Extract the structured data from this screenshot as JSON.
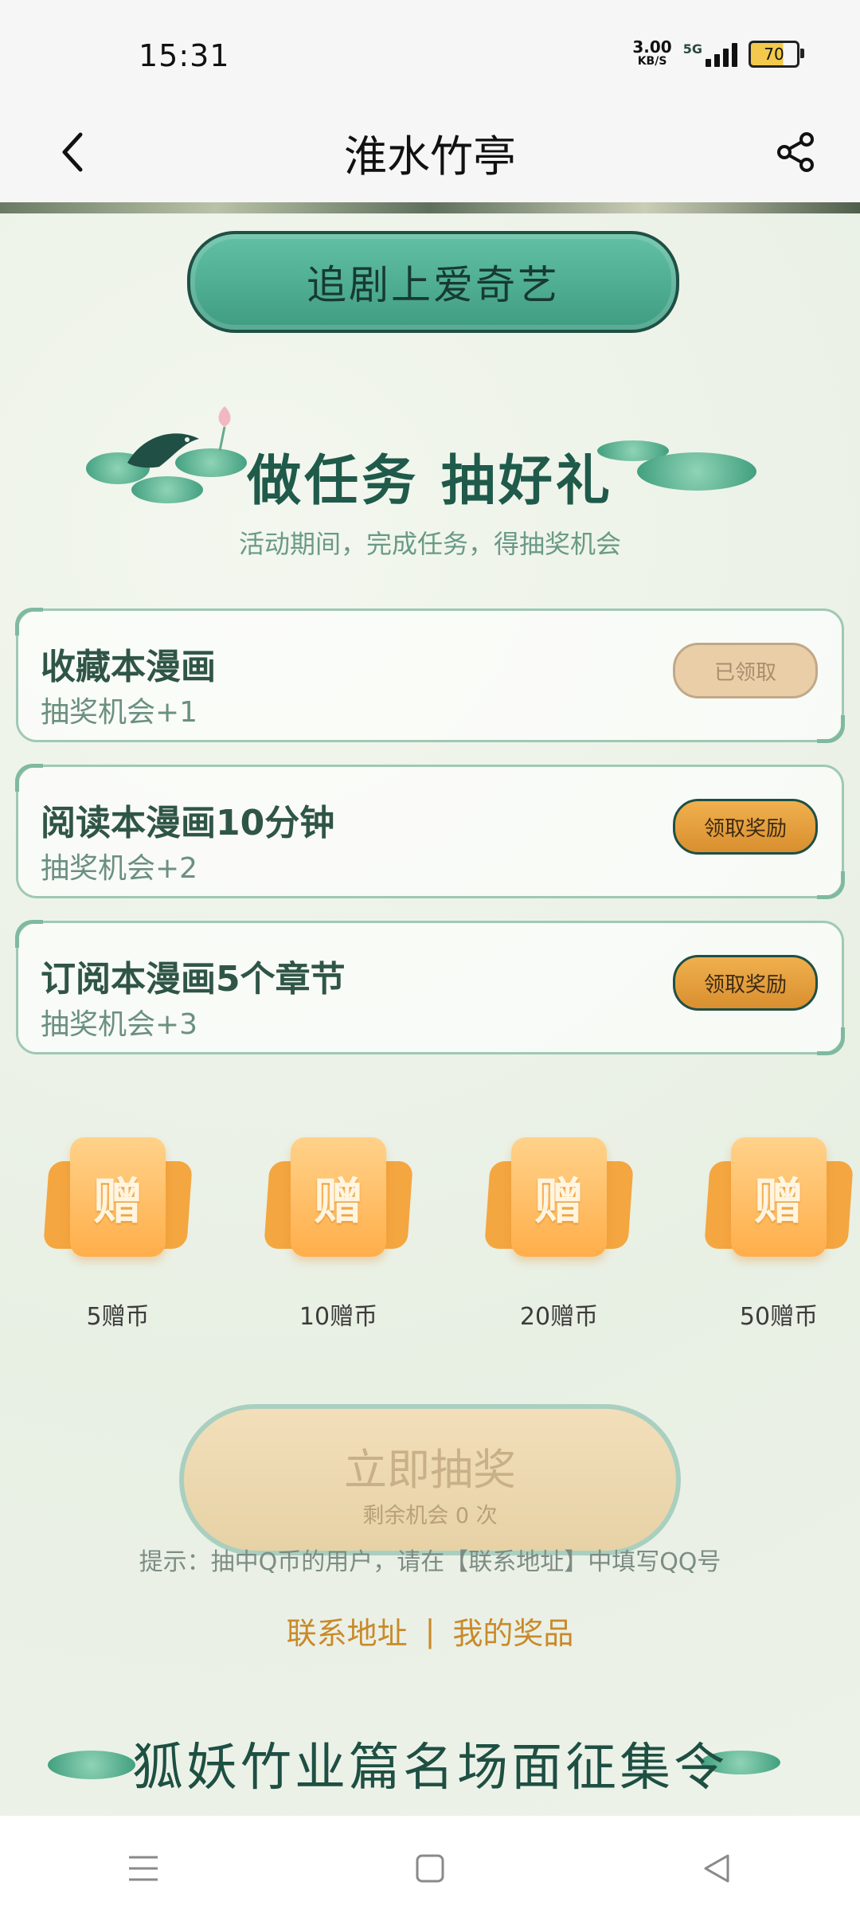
{
  "status": {
    "time": "15:31",
    "net_speed_top": "3.00",
    "net_speed_unit": "KB/S",
    "network": "5G",
    "battery": "70"
  },
  "header": {
    "title": "淮水竹亭"
  },
  "banner": {
    "label": "追剧上爱奇艺"
  },
  "tasks_section": {
    "heading": "做任务 抽好礼",
    "subtitle": "活动期间，完成任务，得抽奖机会",
    "items": [
      {
        "title": "收藏本漫画",
        "reward": "抽奖机会+1",
        "button": "已领取"
      },
      {
        "title": "阅读本漫画10分钟",
        "reward": "抽奖机会+2",
        "button": "领取奖励"
      },
      {
        "title": "订阅本漫画5个章节",
        "reward": "抽奖机会+3",
        "button": "领取奖励"
      }
    ]
  },
  "prizes": {
    "ticket_char": "赠",
    "items": [
      "5赠币",
      "10赠币",
      "20赠币",
      "50赠币"
    ]
  },
  "draw": {
    "main": "立即抽奖",
    "sub": "剩余机会 0 次"
  },
  "tip": "提示：抽中Q币的用户，请在【联系地址】中填写QQ号",
  "links": {
    "contact": "联系地址",
    "separator": "|",
    "my_prizes": "我的奖品"
  },
  "bottom_heading": "狐妖竹业篇名场面征集令",
  "colors": {
    "accent_green": "#3f9c82",
    "gold": "#d98f2f",
    "link": "#c98a2a"
  }
}
